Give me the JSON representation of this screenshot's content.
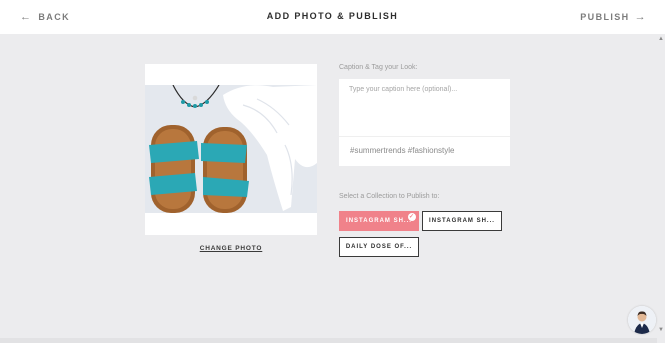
{
  "header": {
    "back_label": "BACK",
    "title": "ADD PHOTO & PUBLISH",
    "publish_label": "PUBLISH"
  },
  "photo": {
    "change_label": "CHANGE PHOTO"
  },
  "caption": {
    "label": "Caption & Tag your Look:",
    "placeholder": "Type your caption here (optional)...",
    "hashtags": "#summertrends #fashionstyle"
  },
  "collections": {
    "label": "Select a Collection to Publish to:",
    "items": [
      {
        "label": "INSTAGRAM SH...",
        "selected": true
      },
      {
        "label": "INSTAGRAM SH...",
        "selected": false
      },
      {
        "label": "DAILY DOSE OF...",
        "selected": false
      }
    ]
  },
  "colors": {
    "accent": "#f0828a",
    "background": "#ececee",
    "sandal_strap": "#2ba8b5",
    "sandal_sole": "#a0622d"
  },
  "icons": [
    "arrow-left-icon",
    "arrow-right-icon",
    "check-icon",
    "scroll-up-icon",
    "scroll-down-icon"
  ]
}
